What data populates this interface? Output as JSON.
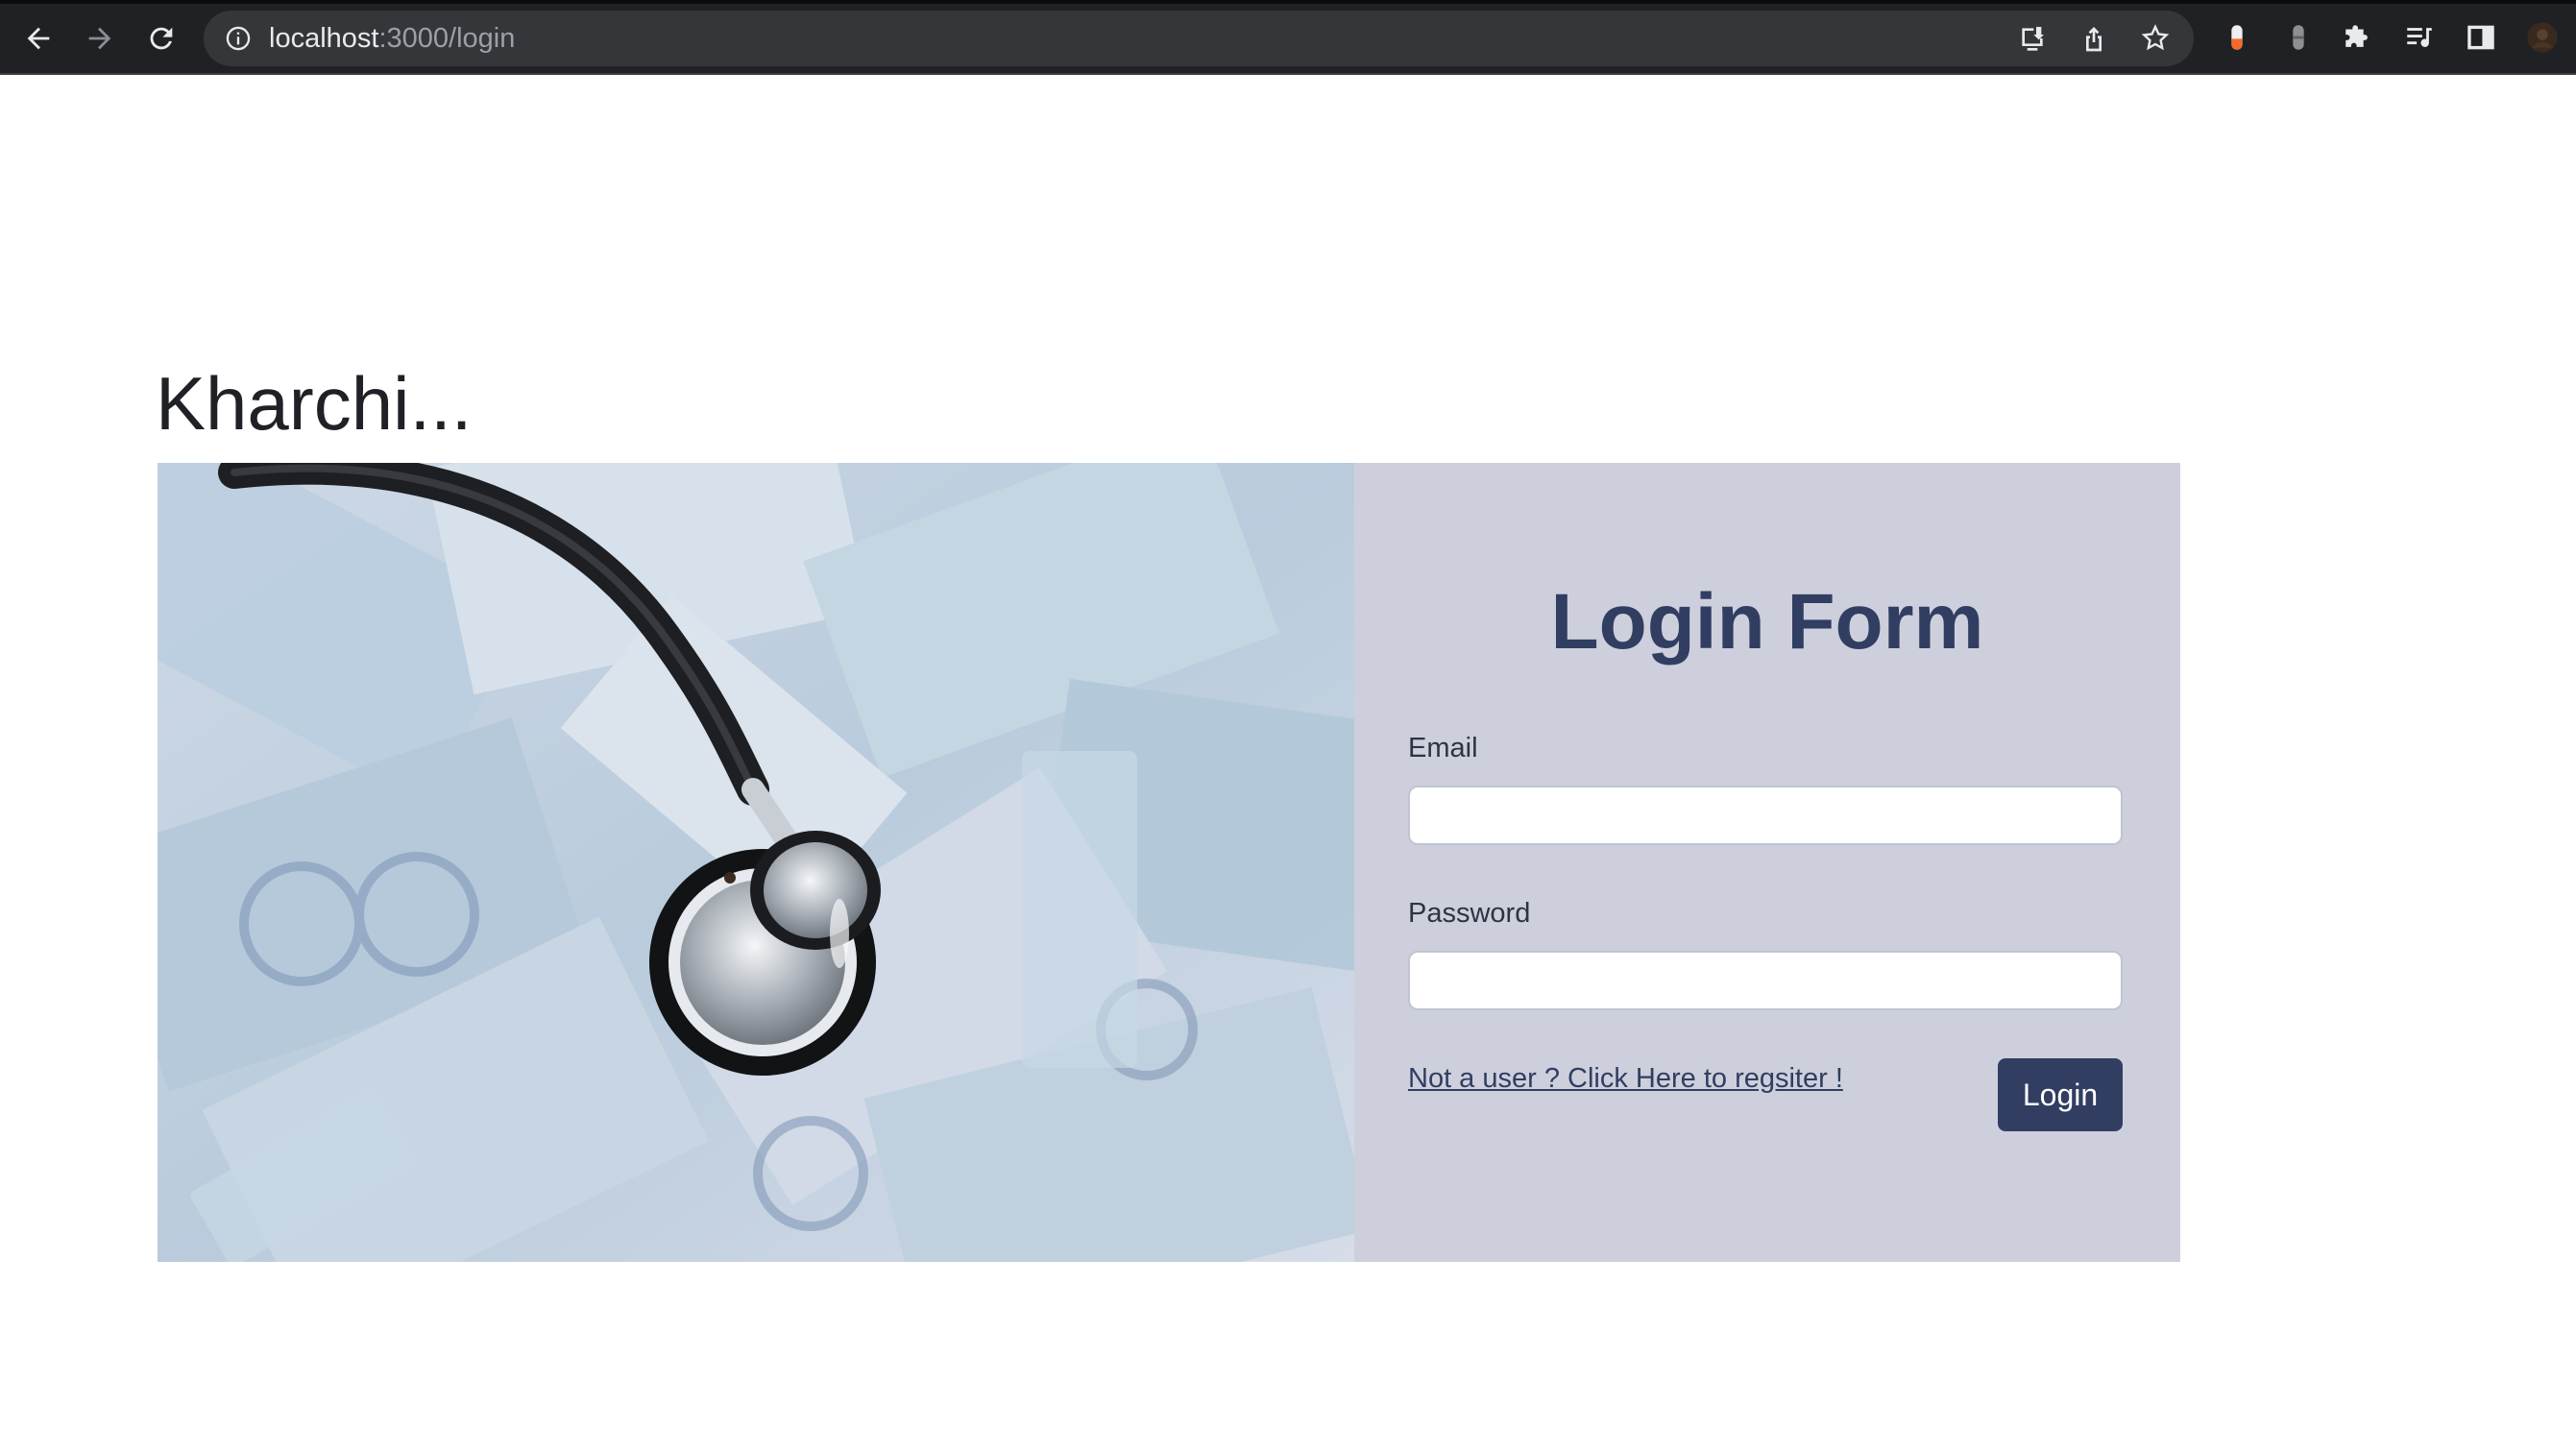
{
  "browser": {
    "url_host": "localhost",
    "url_path": ":3000/login"
  },
  "page": {
    "brand": "Kharchi..."
  },
  "login_form": {
    "title": "Login Form",
    "email_label": "Email",
    "email_value": "",
    "password_label": "Password",
    "password_value": "",
    "register_link": "Not a user ? Click Here to regsiter !",
    "login_button": "Login"
  },
  "colors": {
    "accent": "#313e62",
    "panel_bg": "#cdd0dc",
    "chrome_bg": "#202124"
  },
  "icons": {
    "photo": "stethoscope-on-euro-banknotes-photo"
  }
}
